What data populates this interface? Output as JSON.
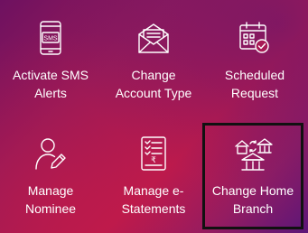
{
  "services": [
    {
      "label": "Activate SMS\nAlerts",
      "icon": "sms-phone-icon",
      "badge": "SMS"
    },
    {
      "label": "Change\nAccount Type",
      "icon": "envelope-icon"
    },
    {
      "label": "Scheduled\nRequest",
      "icon": "calendar-check-icon"
    },
    {
      "label": "Manage\nNominee",
      "icon": "user-edit-icon"
    },
    {
      "label": "Manage e-\nStatements",
      "icon": "rupee-document-icon",
      "currency": "₹"
    },
    {
      "label": "Change Home\nBranch",
      "icon": "bank-home-swap-icon",
      "highlighted": true
    }
  ],
  "colors": {
    "gradient_start": "#6e1160",
    "gradient_mid": "#b81a4e",
    "gradient_end": "#5c1678",
    "highlight_border": "#111111",
    "text": "#ffffff"
  }
}
